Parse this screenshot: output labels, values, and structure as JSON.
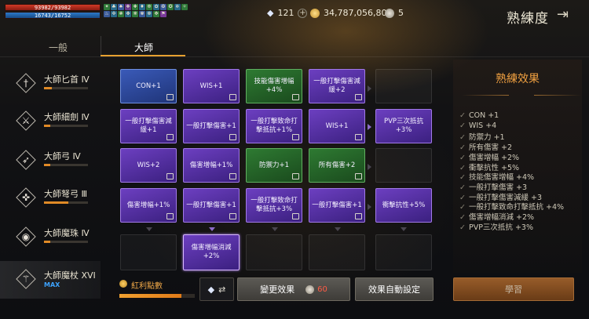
{
  "status": {
    "hp_text": "93982/93982",
    "mp_text": "16743/16752",
    "buff_icons": [
      "✦",
      "♣",
      "♠",
      "❖",
      "✚",
      "♦",
      "❉",
      "✿",
      "❂",
      "✪",
      "❄",
      "✧",
      "♨",
      "✜",
      "❃",
      "✤",
      "❋",
      "✾",
      "❁",
      "✥",
      "⚑"
    ]
  },
  "currency": {
    "diamond_icon": "diamond-icon",
    "diamonds": "121",
    "gold_icon": "gold-coin-icon",
    "gold": "34,787,056,805",
    "tokens": "5"
  },
  "header": {
    "title": "熟練度",
    "exit_icon": "exit-icon"
  },
  "tabs": {
    "normal": "一般",
    "master": "大師"
  },
  "weapons": [
    {
      "name": "大師匕首 Ⅳ",
      "icon": "dagger-icon",
      "glyph": "†",
      "progress": 0.18
    },
    {
      "name": "大師細劍 Ⅳ",
      "icon": "rapier-icon",
      "glyph": "⚔",
      "progress": 0.15
    },
    {
      "name": "大師弓 Ⅳ",
      "icon": "bow-icon",
      "glyph": "➶",
      "progress": 0.15
    },
    {
      "name": "大師弩弓 Ⅲ",
      "icon": "crossbow-icon",
      "glyph": "✜",
      "progress": 0.55
    },
    {
      "name": "大師魔珠 Ⅳ",
      "icon": "orb-icon",
      "glyph": "◉",
      "progress": 0.15
    },
    {
      "name": "大師魔杖 XVI",
      "icon": "staff-icon",
      "glyph": "⚚",
      "max_label": "MAX"
    }
  ],
  "grid": [
    {
      "label": "CON+1",
      "color": "blue"
    },
    {
      "label": "WIS+1",
      "color": "purple"
    },
    {
      "label": "技能傷害增幅+4%",
      "color": "green"
    },
    {
      "label": "一般打擊傷害減緩+2",
      "color": "purple"
    },
    {
      "label": "",
      "color": "empty"
    },
    {
      "label": "一般打擊傷害減緩+1",
      "color": "purple"
    },
    {
      "label": "一般打擊傷害+1",
      "color": "purple"
    },
    {
      "label": "一般打擊致命打擊抵抗+1%",
      "color": "purple"
    },
    {
      "label": "WIS+1",
      "color": "purple"
    },
    {
      "label": "PVP三次抵抗 +3%",
      "color": "purple"
    },
    {
      "label": "WIS+2",
      "color": "purple"
    },
    {
      "label": "傷害增幅+1%",
      "color": "purple"
    },
    {
      "label": "防禦力+1",
      "color": "green"
    },
    {
      "label": "所有傷害+2",
      "color": "green"
    },
    {
      "label": "",
      "color": "empty"
    },
    {
      "label": "傷害增幅+1%",
      "color": "purple"
    },
    {
      "label": "一般打擊傷害+1",
      "color": "purple"
    },
    {
      "label": "一般打擊致命打擊抵抗+3%",
      "color": "purple"
    },
    {
      "label": "一般打擊傷害+1",
      "color": "purple"
    },
    {
      "label": "衝擊抗性+5%",
      "color": "purple"
    },
    {
      "label": "",
      "color": "empty"
    },
    {
      "label": "傷害增幅消減+2%",
      "color": "purple"
    },
    {
      "label": "",
      "color": "empty"
    },
    {
      "label": "",
      "color": "empty"
    },
    {
      "label": "",
      "color": "empty"
    }
  ],
  "effects_panel": {
    "title": "熟練效果",
    "items": [
      "CON +1",
      "WIS +4",
      "防禦力 +1",
      "所有傷害 +2",
      "傷害增幅 +2%",
      "衝擊抗性 +5%",
      "技能傷害增幅 +4%",
      "一般打擊傷害 +3",
      "一般打擊傷害減緩 +3",
      "一般打擊致命打擊抵抗 +4%",
      "傷害增幅消減 +2%",
      "PVP三次抵抗 +3%"
    ]
  },
  "bottom": {
    "bonus_label": "紅利點數",
    "bonus_progress": 0.82,
    "swap_arrow": "⇄",
    "change_effect": "變更效果",
    "change_cost": "60",
    "auto_set": "效果自動設定",
    "learn": "學習"
  },
  "colors": {
    "accent": "#e7a030",
    "blue_tile": "#2d4a9c",
    "purple_tile": "#5a33a8",
    "green_tile": "#2a6a2e",
    "cost_red": "#ff5b45"
  }
}
